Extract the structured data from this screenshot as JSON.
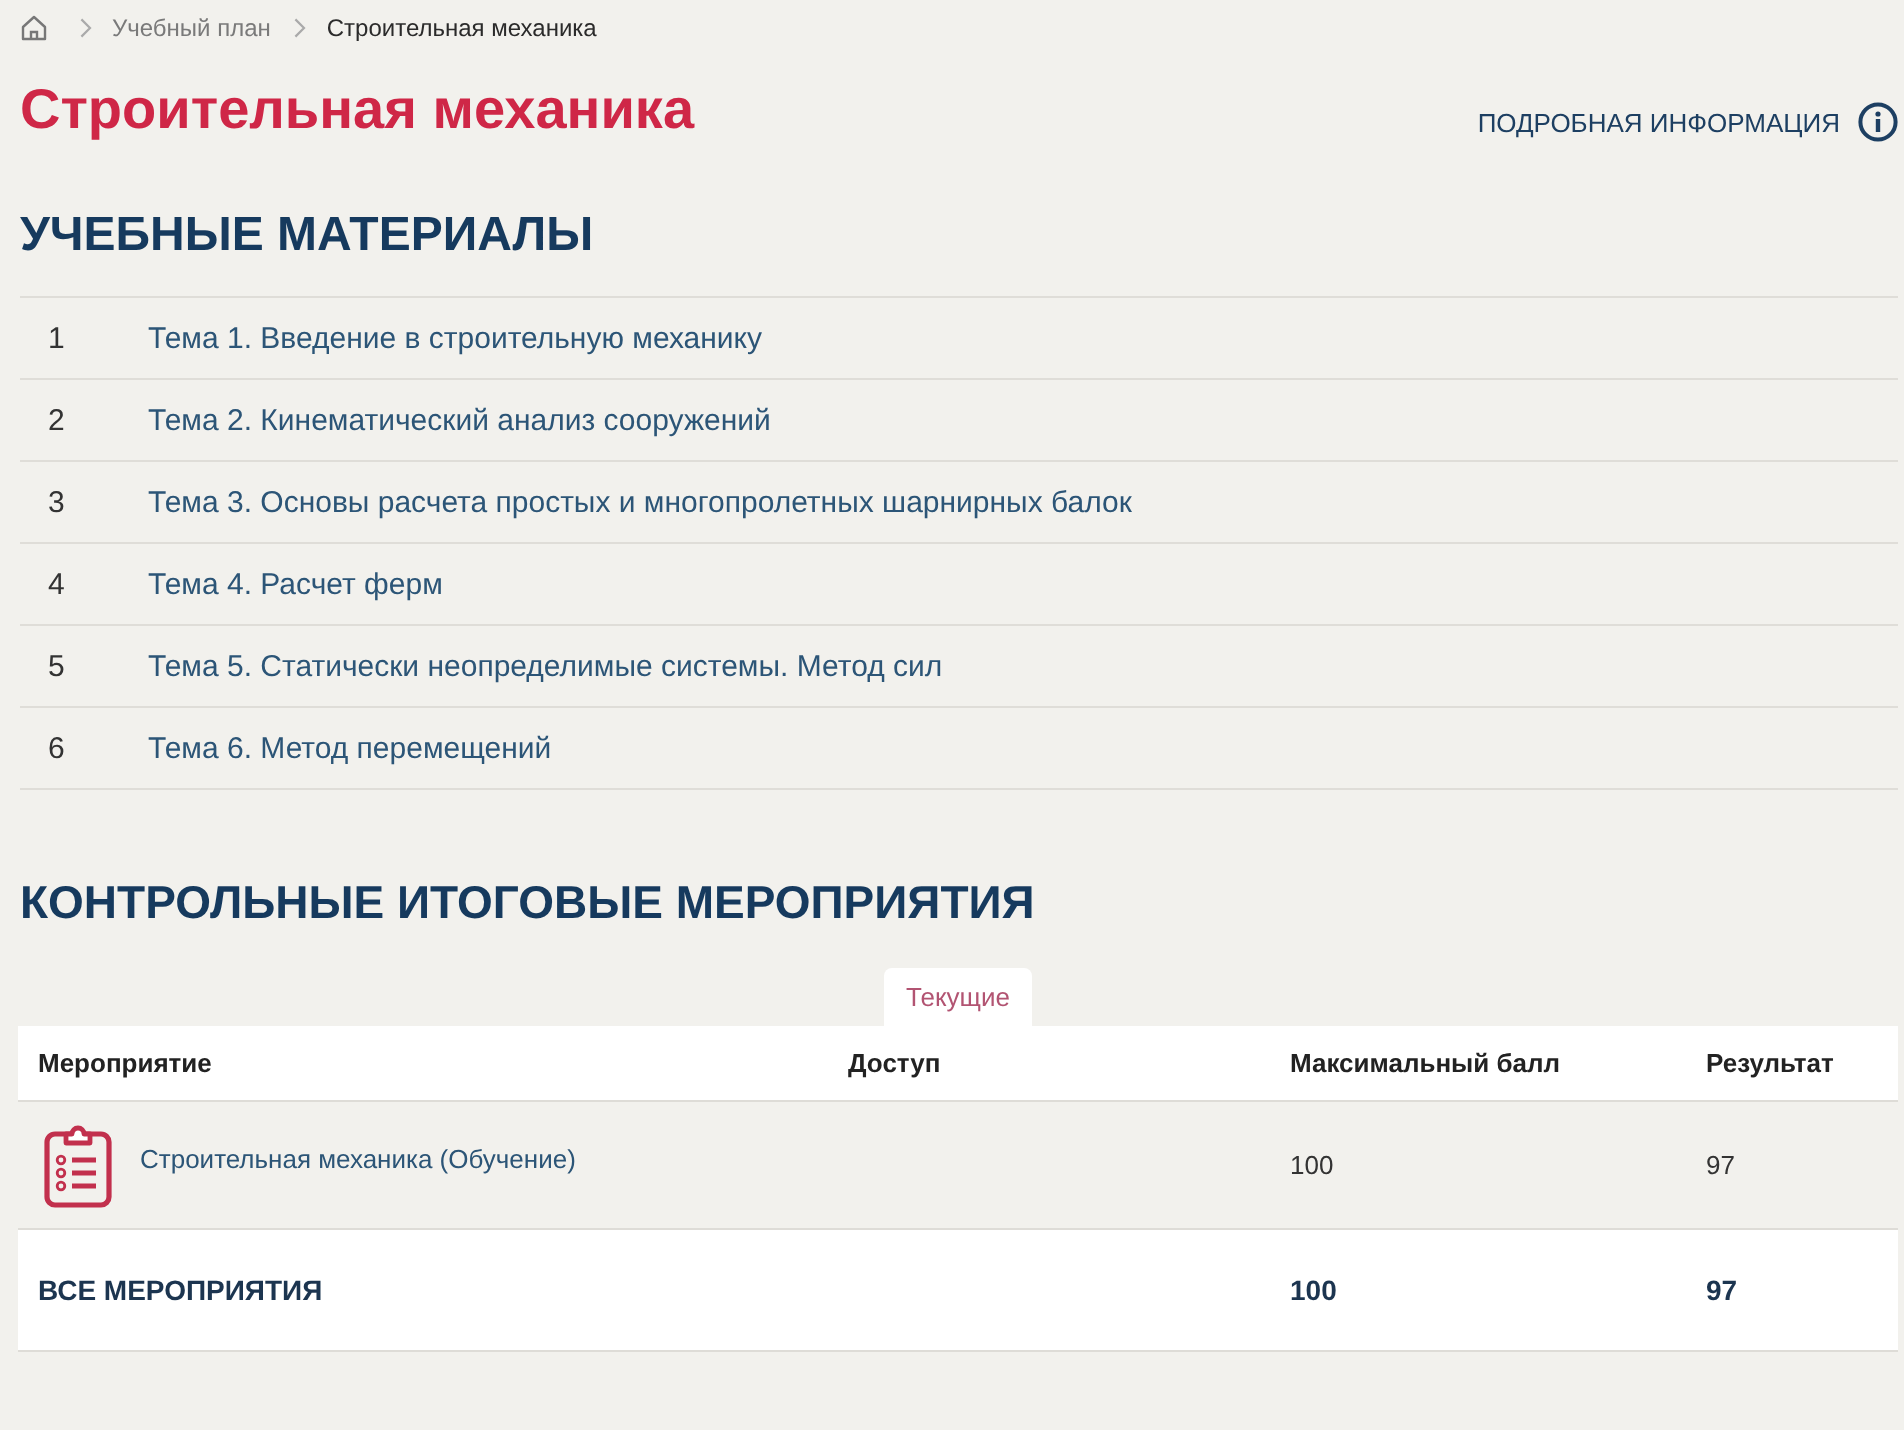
{
  "breadcrumb": [
    {
      "label": "Учебный план",
      "current": false
    },
    {
      "label": "Строительная механика",
      "current": true
    }
  ],
  "page_title": "Строительная механика",
  "details_link": {
    "label": "ПОДРОБНАЯ ИНФОРМАЦИЯ"
  },
  "materials": {
    "heading": "УЧЕБНЫЕ МАТЕРИАЛЫ",
    "items": [
      {
        "number": "1",
        "title": "Тема 1. Введение в строительную механику"
      },
      {
        "number": "2",
        "title": "Тема 2. Кинематический анализ сооружений"
      },
      {
        "number": "3",
        "title": "Тема 3. Основы расчета простых и многопролетных шарнирных балок"
      },
      {
        "number": "4",
        "title": "Тема 4. Расчет ферм"
      },
      {
        "number": "5",
        "title": "Тема 5. Статически неопределимые системы. Метод сил"
      },
      {
        "number": "6",
        "title": "Тема 6. Метод перемещений"
      }
    ]
  },
  "events": {
    "heading": "КОНТРОЛЬНЫЕ ИТОГОВЫЕ МЕРОПРИЯТИЯ",
    "tabs": [
      {
        "label": "Текущие",
        "selected": true
      }
    ],
    "table": {
      "columns": [
        "Мероприятие",
        "Доступ",
        "Максимальный балл",
        "Результат"
      ],
      "rows": [
        {
          "event": "Строительная механика (Обучение)",
          "max_score": "100",
          "result": "97"
        }
      ],
      "total": {
        "label": "ВСЕ МЕРОПРИЯТИЯ",
        "max_score": "100",
        "result": "97"
      }
    }
  }
}
